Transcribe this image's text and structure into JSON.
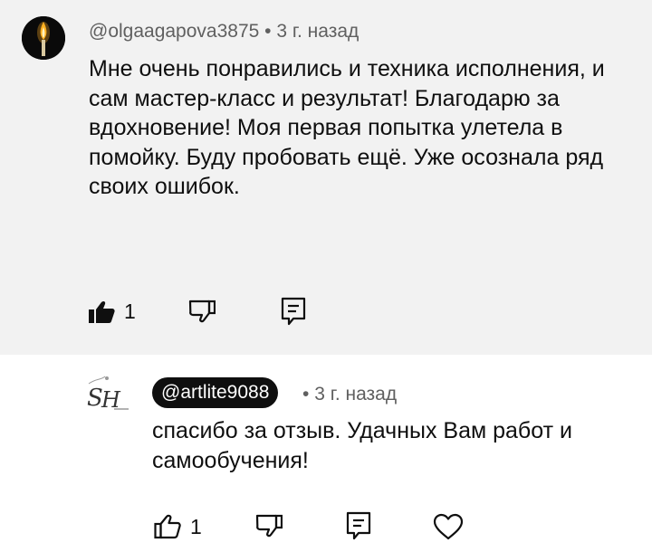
{
  "comment": {
    "author": "@olgaagapova3875",
    "time": "3 г. назад",
    "separator": "•",
    "text": "Мне очень понравились и техника исполнения, и сам мастер-класс и результат! Благодарю за вдохновение! Моя первая попытка улетела в помойку. Буду пробовать ещё. Уже осознала ряд своих ошибок.",
    "likes": "1",
    "icons": {
      "like": "thumbs-up-filled-icon",
      "dislike": "thumbs-down-icon",
      "reply": "reply-icon"
    }
  },
  "reply": {
    "author": "@artlite9088",
    "time": "3 г. назад",
    "separator": "•",
    "text": "спасибо за отзыв. Удачных Вам работ и самообучения!",
    "likes": "1",
    "icons": {
      "like": "thumbs-up-icon",
      "dislike": "thumbs-down-icon",
      "reply": "reply-icon",
      "heart": "heart-icon"
    }
  },
  "colors": {
    "highlight_bg": "#f2f2f2",
    "meta": "#606060",
    "text": "#0f0f0f",
    "chip_bg": "#0f0f0f"
  }
}
